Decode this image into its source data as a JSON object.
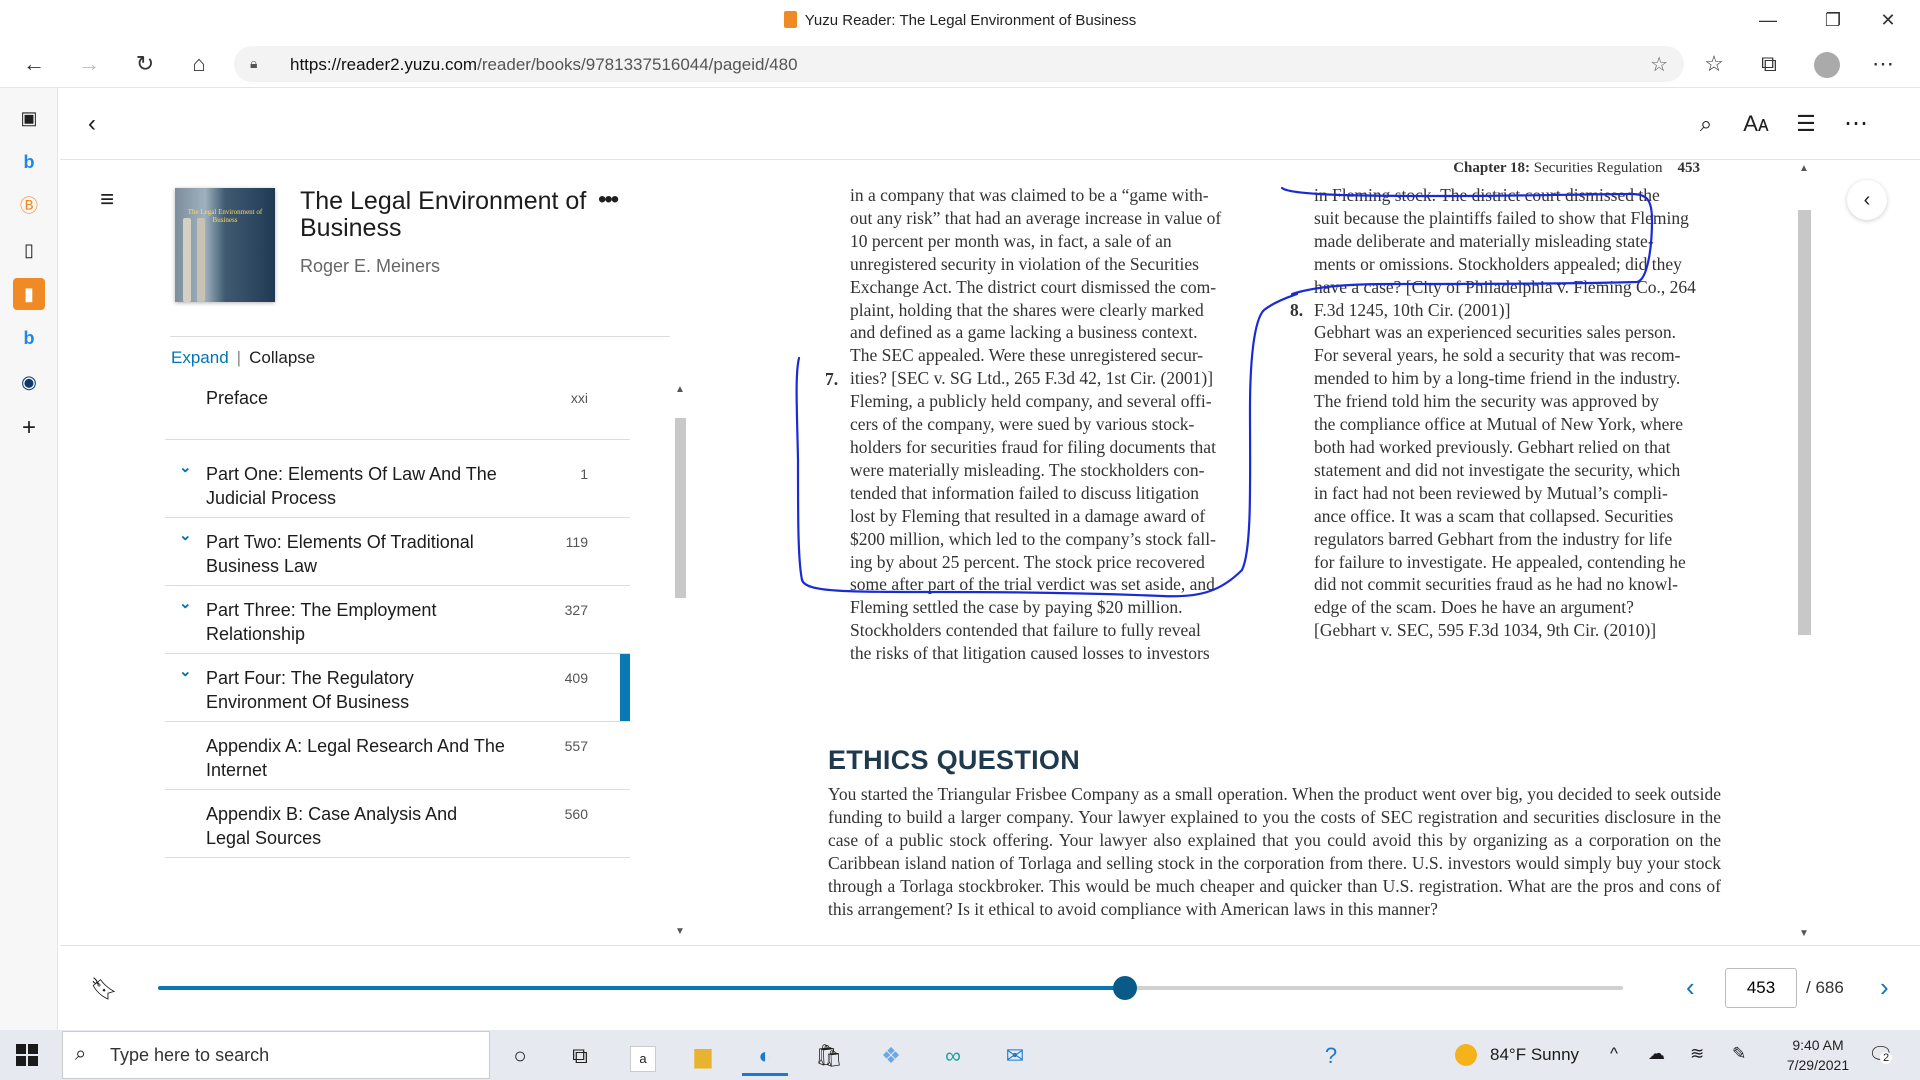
{
  "window": {
    "title": "Yuzu Reader: The Legal Environment of Business",
    "minimize": "—",
    "maximize": "❐",
    "close": "✕"
  },
  "browser": {
    "url_host": "https://reader2.yuzu.com",
    "url_path": "/reader/books/9781337516044/pageid/480"
  },
  "book": {
    "title": "The Legal Environment of Business",
    "author": "Roger E. Meiners",
    "cover_text": "The Legal Environment of Business"
  },
  "toc_controls": {
    "expand": "Expand",
    "separator": "|",
    "collapse": "Collapse"
  },
  "toc": [
    {
      "label": "Preface",
      "page": "xxi",
      "chevron": false,
      "active": false
    },
    {
      "label": "Part One: Elements Of Law And The Judicial Process",
      "page": "1",
      "chevron": true,
      "active": false
    },
    {
      "label": "Part Two: Elements Of Traditional Business Law",
      "page": "119",
      "chevron": true,
      "active": false
    },
    {
      "label": "Part Three: The Employment Relationship",
      "page": "327",
      "chevron": true,
      "active": false
    },
    {
      "label": "Part Four: The Regulatory Environment Of Business",
      "page": "409",
      "chevron": true,
      "active": true
    },
    {
      "label": "Appendix A: Legal Research And The Internet",
      "page": "557",
      "chevron": false,
      "active": false
    },
    {
      "label": "Appendix B: Case Analysis And Legal Sources",
      "page": "560",
      "chevron": false,
      "active": false
    }
  ],
  "page": {
    "header_chapter": "Chapter 18:",
    "header_title": "Securities Regulation",
    "header_page": "453",
    "left_col_lines": [
      "in a company that was claimed to be a “game with-",
      "out any risk” that had an average increase in value of",
      "10 percent per month was, in fact, a sale of an",
      "unregistered security in violation of the Securities",
      "Exchange Act. The district court dismissed the com-",
      "plaint, holding that the shares were clearly marked",
      "and defined as a game lacking a business context.",
      "The SEC appealed. Were these unregistered secur-",
      "ities? [SEC v. SG Ltd., 265 F.3d 42, 1st Cir. (2001)]",
      "Fleming, a publicly held company, and several offi-",
      "cers of the company, were sued by various stock-",
      "holders for securities fraud for filing documents that",
      "were materially misleading. The stockholders con-",
      "tended that information failed to discuss litigation",
      "lost by Fleming that resulted in a damage award of",
      "$200 million, which led to the company’s stock fall-",
      "ing by about 25 percent. The stock price recovered",
      "some after part of the trial verdict was set aside, and",
      "Fleming settled the case by paying $20 million.",
      "Stockholders contended that failure to fully reveal",
      "the risks of that litigation caused losses to investors"
    ],
    "left_num": "7.",
    "right_col_lines": [
      "in Fleming stock. The district court dismissed the",
      "suit because the plaintiffs failed to show that Fleming",
      "made deliberate and materially misleading state-",
      "ments or omissions. Stockholders appealed; did they",
      "have a case? [City of Philadelphia v. Fleming Co., 264",
      "F.3d 1245, 10th Cir. (2001)]",
      "Gebhart was an experienced securities sales person.",
      "For several years, he sold a security that was recom-",
      "mended to him by a long-time friend in the industry.",
      "The friend told him the security was approved by",
      "the compliance office at Mutual of New York, where",
      "both had worked previously. Gebhart relied on that",
      "statement and did not investigate the security, which",
      "in fact had not been reviewed by Mutual’s compli-",
      "ance office. It was a scam that collapsed. Securities",
      "regulators barred Gebhart from the industry for life",
      "for failure to investigate. He appealed, contending he",
      "did not commit securities fraud as he had no knowl-",
      "edge of the scam. Does he have an argument?",
      "[Gebhart v. SEC, 595 F.3d 1034, 9th Cir. (2010)]"
    ],
    "right_num": "8.",
    "ethics_heading": "ETHICS QUESTION",
    "ethics_text": "You started the Triangular Frisbee Company as a small operation. When the product went over big, you decided to seek outside funding to build a larger company. Your lawyer explained to you the costs of SEC registration and securities disclosure in the case of a public stock offering. Your lawyer also explained that you could avoid this by organizing as a corporation on the Caribbean island nation of Torlaga and selling stock in the corporation from there. U.S. investors would simply buy your stock through a Torlaga stockbroker. This would be much cheaper and quicker than U.S. registration. What are the pros and cons of this arrangement? Is it ethical to avoid compliance with American laws in this manner?"
  },
  "footer": {
    "current_page": "453",
    "total_pages": "/ 686",
    "progress_fraction": 0.66
  },
  "taskbar": {
    "search_placeholder": "Type here to search",
    "weather": "84°F  Sunny",
    "time": "9:40 AM",
    "date": "7/29/2021",
    "notif_count": "2"
  },
  "colors": {
    "accent": "#0a78b4",
    "annotation_ink": "#1a2bd6"
  }
}
